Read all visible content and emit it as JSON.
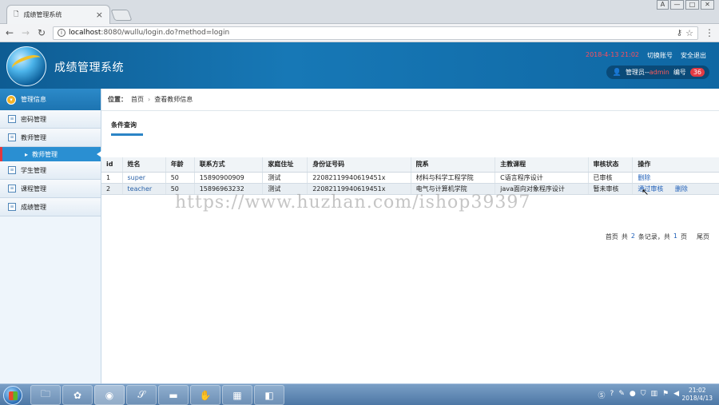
{
  "browser": {
    "tab_title": "成绩管理系统",
    "tab_close": "×",
    "window_controls": [
      "A",
      "—",
      "□",
      "✕"
    ],
    "url_host": "localhost",
    "url_rest": ":8080/wullu/login.do?method=login"
  },
  "header": {
    "app_title": "成绩管理系统",
    "date": "2018-4-13 21:02",
    "switch_account": "切换账号",
    "logout": "安全退出",
    "user_prefix": "管理员--",
    "user_name": "admin",
    "id_label": "编号",
    "id_value": "36"
  },
  "sidebar": {
    "title": "管理信息",
    "items": [
      {
        "label": "密码管理"
      },
      {
        "label": "教师管理"
      },
      {
        "label": "学生管理"
      },
      {
        "label": "课程管理"
      },
      {
        "label": "成绩管理"
      }
    ],
    "sub_item": "教师管理"
  },
  "main": {
    "breadcrumb_label": "位置：",
    "breadcrumb_home": "首页",
    "breadcrumb_current": "查看教师信息",
    "condition_tab": "条件查询",
    "columns": [
      "id",
      "姓名",
      "年龄",
      "联系方式",
      "家庭住址",
      "身份证号码",
      "院系",
      "主教课程",
      "审核状态",
      "操作"
    ],
    "rows": [
      {
        "id": "1",
        "name": "super",
        "age": "50",
        "phone": "15890900909",
        "address": "测试",
        "idcard": "220821199406194​51x",
        "dept": "材料与科学工程学院",
        "course": "C语言程序设计",
        "status": "已审核",
        "action1": "删除",
        "action2": ""
      },
      {
        "id": "2",
        "name": "teacher",
        "age": "50",
        "phone": "15896963232",
        "address": "测试",
        "idcard": "220821199406194​51x",
        "dept": "电气与计算机学院",
        "course": "java面向对象程序设计",
        "status": "暂未审核",
        "action1": "通过审核",
        "action2": "删除"
      }
    ],
    "pager": {
      "first": "首页",
      "total_prefix": "共",
      "total_records": "2",
      "total_suffix": "条记录，共",
      "total_pages": "1",
      "pages_suffix": "页",
      "last": "尾页"
    }
  },
  "watermark": "https://www.huzhan.com/ishop39397",
  "taskbar": {
    "clock_time": "21:02",
    "clock_date": "2018/4/13"
  }
}
